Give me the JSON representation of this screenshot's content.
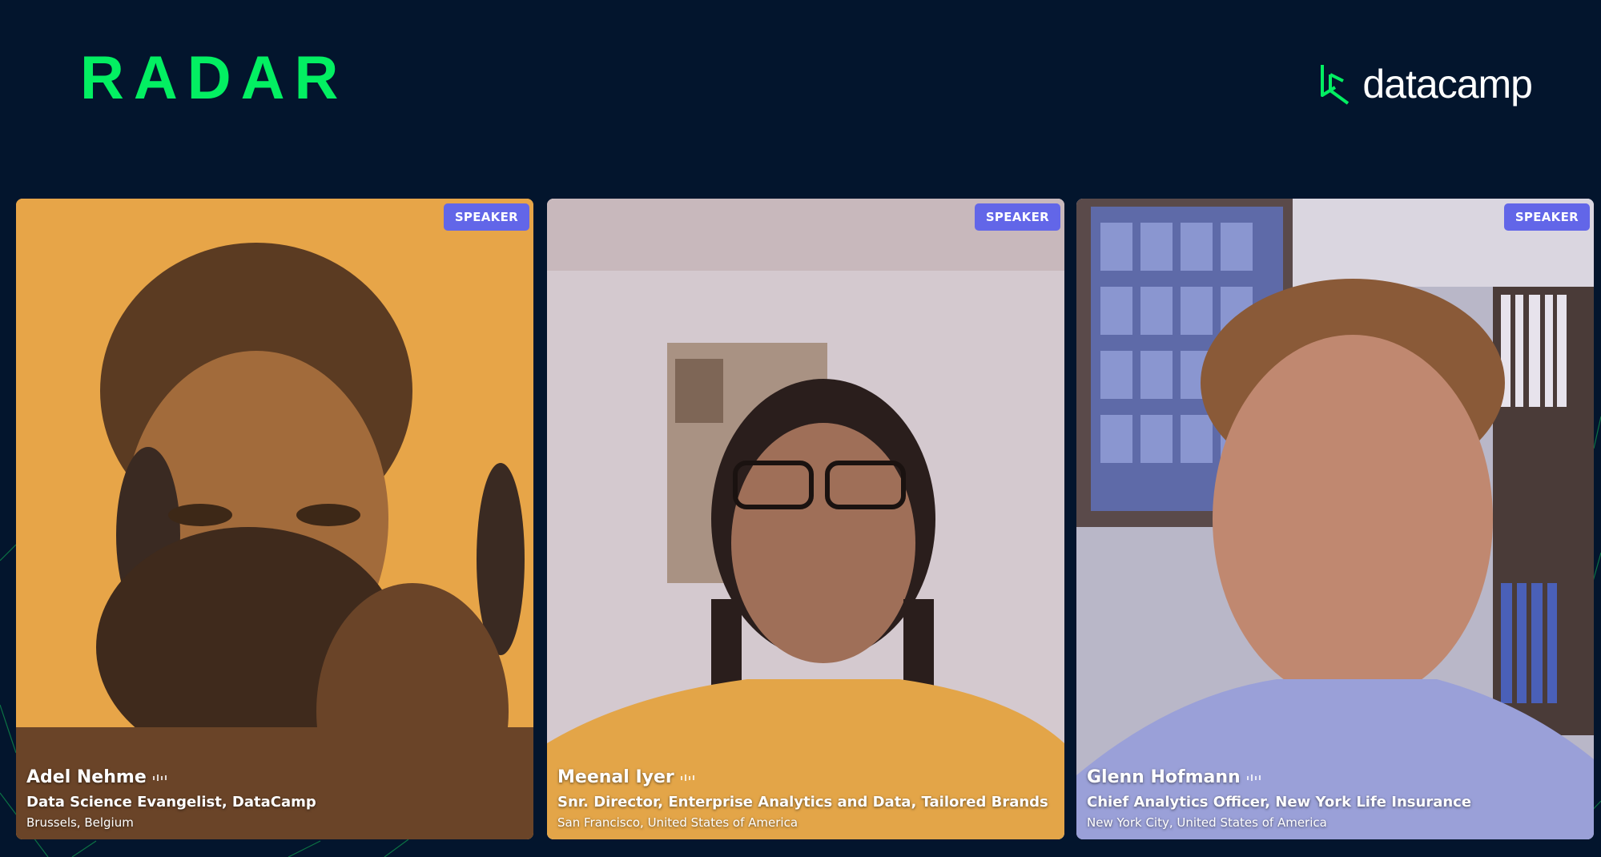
{
  "header": {
    "event_logo": "RADAR",
    "sponsor_logo": "datacamp",
    "colors": {
      "background": "#03152d",
      "event_green": "#03ef62",
      "badge": "#6266e8"
    }
  },
  "participants": [
    {
      "name": "Adel Nehme",
      "title": "Data Science Evangelist, DataCamp",
      "location": "Brussels, Belgium",
      "badge": "SPEAKER"
    },
    {
      "name": "Meenal Iyer",
      "title": "Snr. Director, Enterprise Analytics and Data, Tailored Brands",
      "location": "San Francisco, United States of America",
      "badge": "SPEAKER"
    },
    {
      "name": "Glenn Hofmann",
      "title": "Chief Analytics Officer, New York Life Insurance",
      "location": "New York City, United States of America",
      "badge": "SPEAKER"
    }
  ]
}
